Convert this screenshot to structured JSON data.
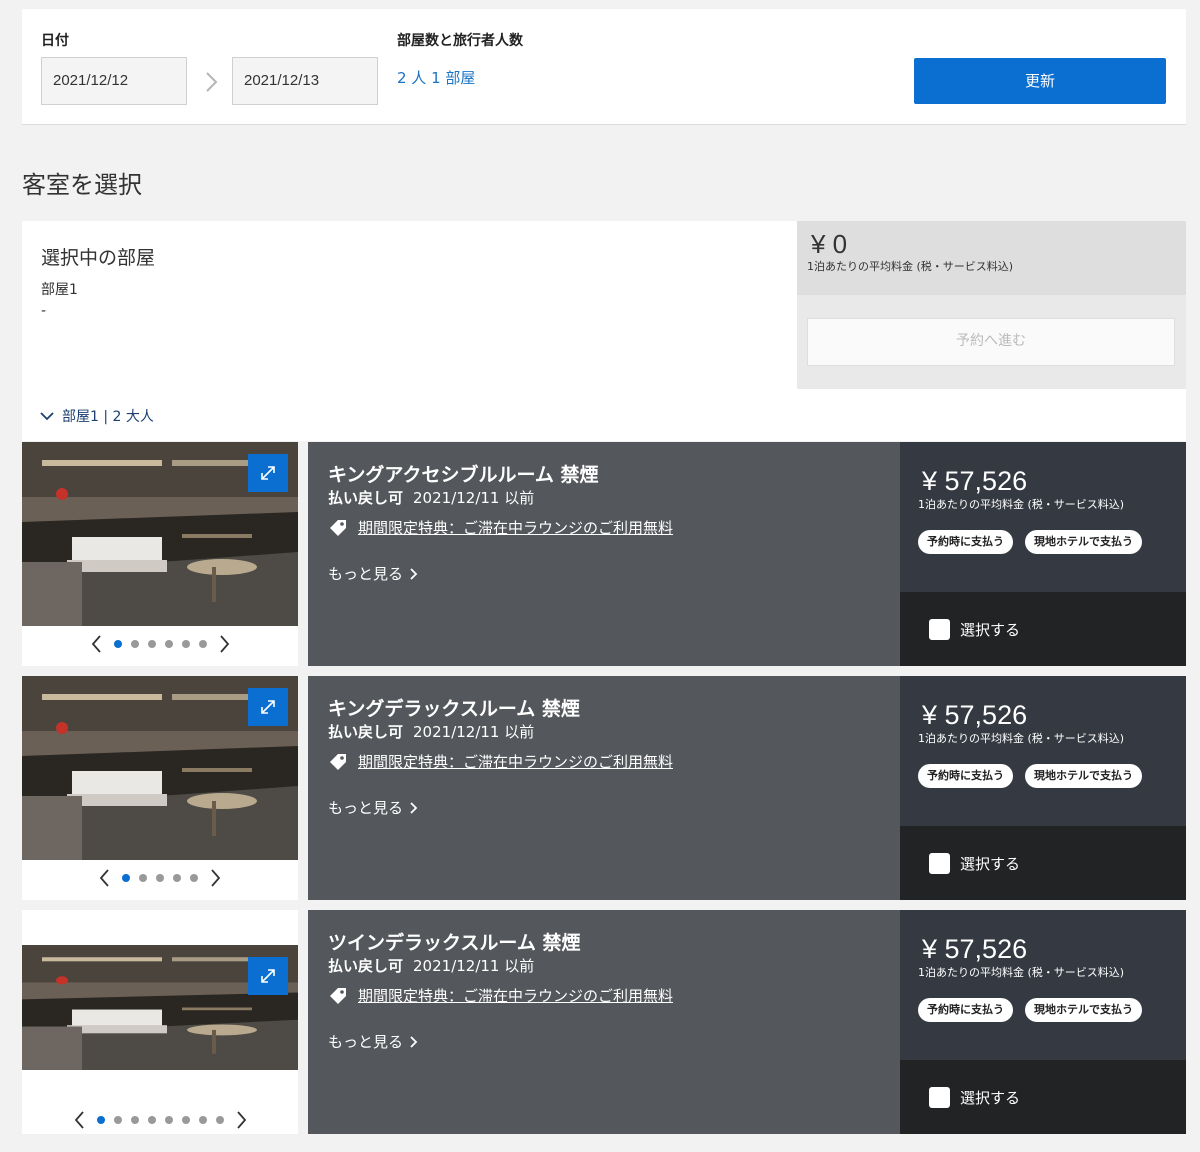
{
  "search": {
    "date_label": "日付",
    "checkin": "2021/12/12",
    "checkout": "2021/12/13",
    "guests_label": "部屋数と旅行者人数",
    "guests_value": "2 人 1 部屋",
    "update_label": "更新"
  },
  "page_title": "客室を選択",
  "summary": {
    "heading": "選択中の部屋",
    "room": "部屋1",
    "room_value": "-",
    "price": "¥ 0",
    "price_note": "1泊あたりの平均料金 (税・サービス料込)",
    "proceed_label": "予約へ進む",
    "room_toggle": "部屋1 | 2 大人"
  },
  "rooms": [
    {
      "name": "キングアクセシブルルーム 禁煙",
      "refund_label": "払い戻し可",
      "refund_date": "2021/12/11 以前",
      "perk": "期間限定特典：ご滞在中ラウンジのご利用無料",
      "more": "もっと見る",
      "price": "¥ 57,526",
      "price_note": "1泊あたりの平均料金 (税・サービス料込)",
      "pay_now": "予約時に支払う",
      "pay_hotel": "現地ホテルで支払う",
      "select": "選択する",
      "photo_count": 6
    },
    {
      "name": "キングデラックスルーム 禁煙",
      "refund_label": "払い戻し可",
      "refund_date": "2021/12/11 以前",
      "perk": "期間限定特典：ご滞在中ラウンジのご利用無料",
      "more": "もっと見る",
      "price": "¥ 57,526",
      "price_note": "1泊あたりの平均料金 (税・サービス料込)",
      "pay_now": "予約時に支払う",
      "pay_hotel": "現地ホテルで支払う",
      "select": "選択する",
      "photo_count": 5
    },
    {
      "name": "ツインデラックスルーム 禁煙",
      "refund_label": "払い戻し可",
      "refund_date": "2021/12/11 以前",
      "perk": "期間限定特典：ご滞在中ラウンジのご利用無料",
      "more": "もっと見る",
      "price": "¥ 57,526",
      "price_note": "1泊あたりの平均料金 (税・サービス料込)",
      "pay_now": "予約時に支払う",
      "pay_hotel": "現地ホテルで支払う",
      "select": "選択する",
      "photo_count": 8
    }
  ],
  "colors": {
    "accent": "#0a6fd0",
    "card_info_bg": "#54575b",
    "card_price_bg": "#353a42",
    "card_select_bg": "#222324"
  },
  "icons": [
    "chevron-right-icon",
    "chevron-down-icon",
    "expand-icon",
    "tag-icon",
    "chevron-left-icon"
  ]
}
